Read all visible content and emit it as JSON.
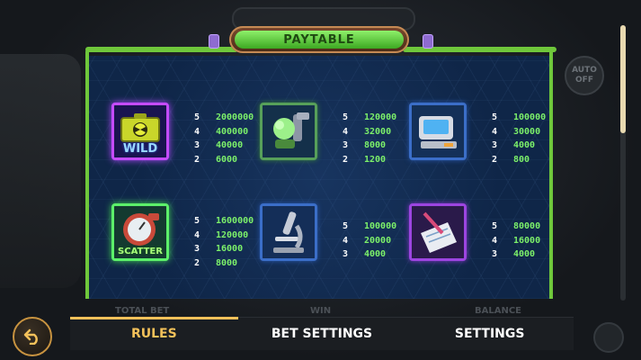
{
  "header": {
    "title": "PAYTABLE"
  },
  "background": {
    "auto_button": "AUTO\nOFF"
  },
  "symbols": [
    {
      "id": "wild",
      "label": "WILD",
      "pays": [
        [
          "5",
          "2000000"
        ],
        [
          "4",
          "400000"
        ],
        [
          "3",
          "40000"
        ],
        [
          "2",
          "6000"
        ]
      ]
    },
    {
      "id": "brain-machine",
      "label": "",
      "pays": [
        [
          "5",
          "120000"
        ],
        [
          "4",
          "32000"
        ],
        [
          "3",
          "8000"
        ],
        [
          "2",
          "1200"
        ]
      ]
    },
    {
      "id": "computer",
      "label": "",
      "pays": [
        [
          "5",
          "100000"
        ],
        [
          "4",
          "30000"
        ],
        [
          "3",
          "4000"
        ],
        [
          "2",
          "800"
        ]
      ]
    },
    {
      "id": "scatter",
      "label": "SCATTER",
      "pays": [
        [
          "5",
          "1600000"
        ],
        [
          "4",
          "120000"
        ],
        [
          "3",
          "16000"
        ],
        [
          "2",
          "8000"
        ]
      ]
    },
    {
      "id": "microscope",
      "label": "",
      "pays": [
        [
          "5",
          "100000"
        ],
        [
          "4",
          "20000"
        ],
        [
          "3",
          "4000"
        ]
      ]
    },
    {
      "id": "notepad",
      "label": "",
      "pays": [
        [
          "5",
          "80000"
        ],
        [
          "4",
          "16000"
        ],
        [
          "3",
          "4000"
        ]
      ]
    }
  ],
  "bottom": {
    "ghost_labels": [
      "TOTAL BET",
      "WIN",
      "BALANCE"
    ],
    "tabs": [
      {
        "label": "RULES",
        "active": true
      },
      {
        "label": "BET SETTINGS",
        "active": false
      },
      {
        "label": "SETTINGS",
        "active": false
      }
    ]
  },
  "colors": {
    "accent": "#f3c15a",
    "pay_value": "#7cf06a",
    "pipe": "#6fc73b"
  }
}
